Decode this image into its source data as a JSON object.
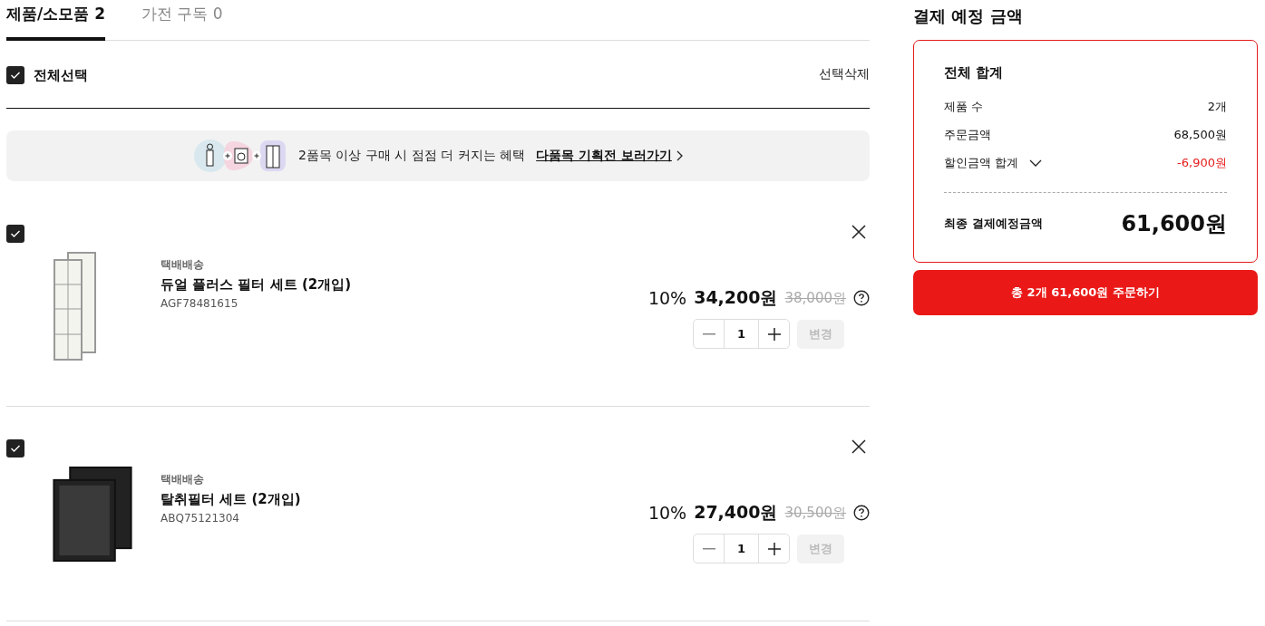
{
  "tabs": [
    {
      "label": "제품/소모품 2",
      "selected": true
    },
    {
      "label": "가전 구독 0",
      "selected": false
    }
  ],
  "select_all": {
    "label": "전체선택",
    "checked": true
  },
  "delete_selected": "선택삭제",
  "banner": {
    "text": "2품목 이상 구매 시 점점 더 커지는 혜택",
    "link": "다품목 기획전 보러가기"
  },
  "items": [
    {
      "checked": true,
      "kind": "white",
      "delivery": "택배배송",
      "name": "듀얼 플러스 필터 세트 (2개입)",
      "code": "AGF78481615",
      "discount": "10%",
      "price": "34,200원",
      "original_price": "38,000원",
      "quantity": "1",
      "change": "변경",
      "change_disabled": true
    },
    {
      "checked": true,
      "kind": "black",
      "delivery": "택배배송",
      "name": "탈취필터 세트 (2개입)",
      "code": "ABQ75121304",
      "discount": "10%",
      "price": "27,400원",
      "original_price": "30,500원",
      "quantity": "1",
      "change": "변경",
      "change_disabled": true
    }
  ],
  "summary": {
    "title": "결제 예정 금액",
    "subtitle": "전체 합계",
    "rows": [
      {
        "kind": "plain",
        "label": "제품 수",
        "value": "2개"
      },
      {
        "kind": "plain",
        "label": "주문금액",
        "value": "68,500원"
      },
      {
        "kind": "discount",
        "label": "할인금액 합계",
        "value": "-6,900원",
        "expanded": false
      }
    ],
    "final_label": "최종 결제예정금액",
    "final_value": "61,600원",
    "order_button": "총 2개 61,600원 주문하기"
  }
}
